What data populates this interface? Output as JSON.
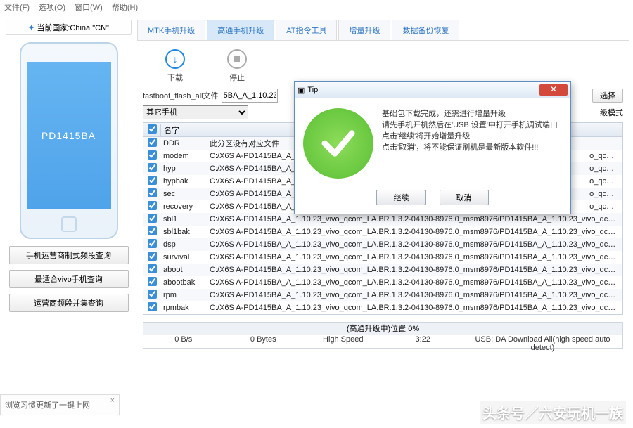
{
  "menu": {
    "file": "文件(F)",
    "opts": "选项(O)",
    "win": "窗口(W)",
    "help": "帮助(H)"
  },
  "country": {
    "label": "当前国家",
    "value": "China \"CN\""
  },
  "phone_model": "PD1415BA",
  "side_buttons": {
    "b1": "手机运营商制式频段查询",
    "b2": "最适合vivo手机查询",
    "b3": "运营商频段并集查询"
  },
  "tabs": {
    "t1": "MTK手机升级",
    "t2": "高通手机升级",
    "t3": "AT指令工具",
    "t4": "增量升级",
    "t5": "数据备份恢复"
  },
  "toolbar": {
    "download": "下载",
    "stop": "停止"
  },
  "form": {
    "label1": "fastboot_flash_all文件",
    "file_value": "5BA_A_1.10.23_",
    "select_btn": "选择",
    "device_sel": "其它手机",
    "mode_suffix": "级模式"
  },
  "table": {
    "head_name": "名字",
    "rows": [
      {
        "n": "DDR",
        "p": "此分区没有对应文件"
      },
      {
        "n": "modem",
        "p": "C:/X6S A-PD1415BA_A_…"
      },
      {
        "n": "hyp",
        "p": "C:/X6S A-PD1415BA_A_…"
      },
      {
        "n": "hypbak",
        "p": "C:/X6S A-PD1415BA_A_…"
      },
      {
        "n": "sec",
        "p": "C:/X6S A-PD1415BA_A_…"
      },
      {
        "n": "recovery",
        "p": "C:/X6S A-PD1415BA_A_…"
      },
      {
        "n": "sbl1",
        "p": "C:/X6S A-PD1415BA_A_1.10.23_vivo_qcom_LA.BR.1.3.2-04130-8976.0_msm8976/PD1415BA_A_1.10.23_vivo_qc…"
      },
      {
        "n": "sbl1bak",
        "p": "C:/X6S A-PD1415BA_A_1.10.23_vivo_qcom_LA.BR.1.3.2-04130-8976.0_msm8976/PD1415BA_A_1.10.23_vivo_qc…"
      },
      {
        "n": "dsp",
        "p": "C:/X6S A-PD1415BA_A_1.10.23_vivo_qcom_LA.BR.1.3.2-04130-8976.0_msm8976/PD1415BA_A_1.10.23_vivo_qc…"
      },
      {
        "n": "survival",
        "p": "C:/X6S A-PD1415BA_A_1.10.23_vivo_qcom_LA.BR.1.3.2-04130-8976.0_msm8976/PD1415BA_A_1.10.23_vivo_qc…"
      },
      {
        "n": "aboot",
        "p": "C:/X6S A-PD1415BA_A_1.10.23_vivo_qcom_LA.BR.1.3.2-04130-8976.0_msm8976/PD1415BA_A_1.10.23_vivo_qc…"
      },
      {
        "n": "abootbak",
        "p": "C:/X6S A-PD1415BA_A_1.10.23_vivo_qcom_LA.BR.1.3.2-04130-8976.0_msm8976/PD1415BA_A_1.10.23_vivo_qc…"
      },
      {
        "n": "rpm",
        "p": "C:/X6S A-PD1415BA_A_1.10.23_vivo_qcom_LA.BR.1.3.2-04130-8976.0_msm8976/PD1415BA_A_1.10.23_vivo_qc…"
      },
      {
        "n": "rpmbak",
        "p": "C:/X6S A-PD1415BA_A_1.10.23_vivo_qcom_LA.BR.1.3.2-04130-8976.0_msm8976/PD1415BA_A_1.10.23_vivo_qc…"
      }
    ],
    "tail_suffix": "o_qc…"
  },
  "status": {
    "header": "(高通升级中)位置 0%",
    "c1": "0 B/s",
    "c2": "0 Bytes",
    "c3": "High Speed",
    "c4": "3:22",
    "c5": "USB: DA Download All(high speed,auto detect)"
  },
  "dialog": {
    "title": "Tip",
    "line1": "基础包下载完成，还需进行增量升级",
    "line2": "请先手机开机然后在'USB 设置'中打开手机调试端口",
    "line3": "点击'继续'将开始增量升级",
    "line4": "点击'取消'，将不能保证刷机是最新版本软件!!!",
    "ok": "继续",
    "cancel": "取消"
  },
  "toast": {
    "text": "浏览习惯更新了一键上网"
  },
  "watermark": "头条号／六安玩机一族"
}
